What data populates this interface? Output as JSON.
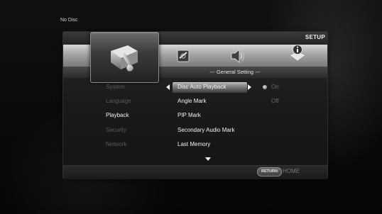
{
  "status": {
    "disc": "No Disc"
  },
  "header": {
    "title": "SETUP"
  },
  "tabs": [
    {
      "name": "general",
      "icon": "tools-icon",
      "active": true
    },
    {
      "name": "display",
      "icon": "disc-icon",
      "active": false
    },
    {
      "name": "audio",
      "icon": "speaker-icon",
      "active": false
    },
    {
      "name": "information",
      "icon": "info-icon",
      "active": false
    }
  ],
  "section": {
    "title": "--- General Setting ---"
  },
  "sidebar": {
    "items": [
      {
        "label": "System",
        "active": false
      },
      {
        "label": "Language",
        "active": false
      },
      {
        "label": "Playback",
        "active": true
      },
      {
        "label": "Security",
        "active": false
      },
      {
        "label": "Network",
        "active": false
      }
    ]
  },
  "options": {
    "items": [
      {
        "label": "Disc Auto Playback",
        "selected": true
      },
      {
        "label": "Angle Mark",
        "selected": false
      },
      {
        "label": "PIP Mark",
        "selected": false
      },
      {
        "label": "Secondary Audio Mark",
        "selected": false
      },
      {
        "label": "Last Memory",
        "selected": false
      }
    ]
  },
  "values": {
    "item0": "On",
    "item1": "Off"
  },
  "footer": {
    "return_label": "RETURN",
    "home_label": "HOME"
  },
  "colors": {
    "accent_bar": "#a4a4a4",
    "selection": "#8a8a8a",
    "inactive_text": "#5a5a5a"
  }
}
